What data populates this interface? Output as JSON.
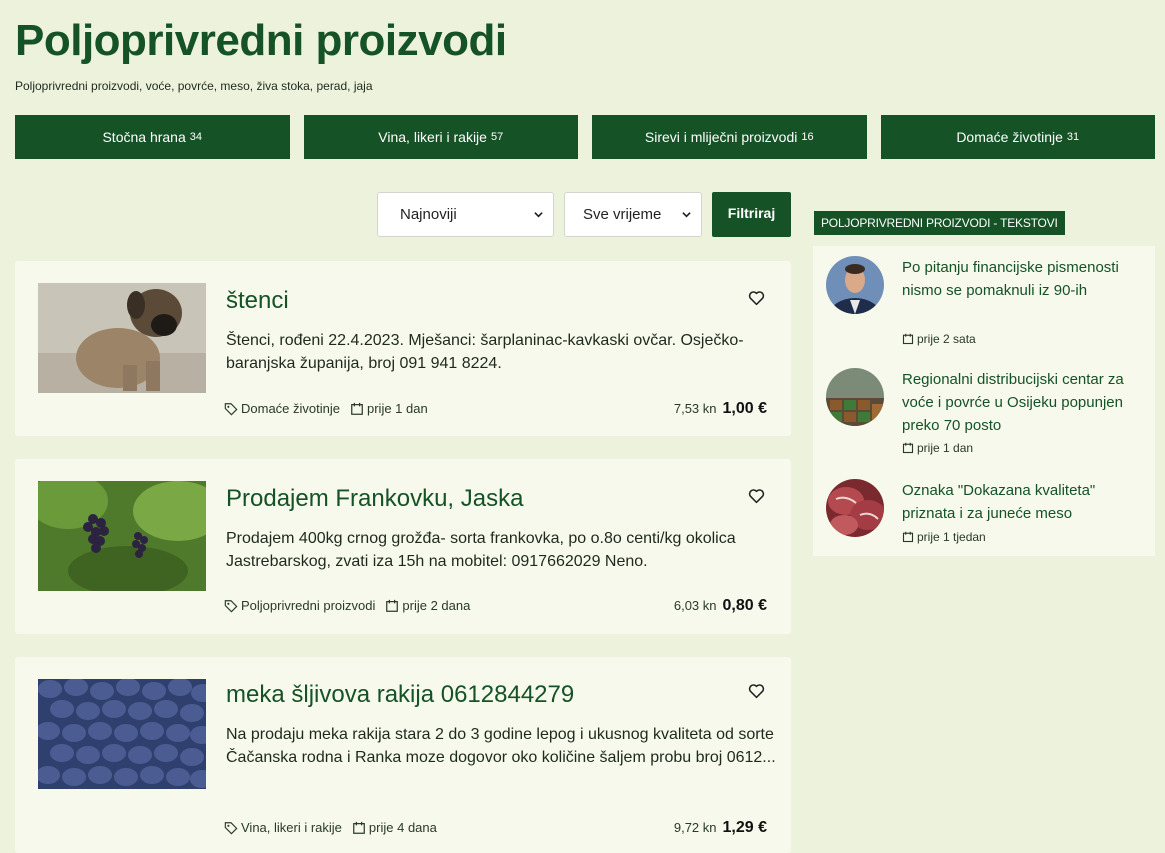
{
  "header": {
    "title": "Poljoprivredni proizvodi",
    "subtitle": "Poljoprivredni proizvodi, voće, povrće, meso, živa stoka, perad, jaja"
  },
  "categories": [
    {
      "label": "Stočna hrana",
      "count": "34"
    },
    {
      "label": "Vina, likeri i rakije",
      "count": "57"
    },
    {
      "label": "Sirevi i mliječni proizvodi",
      "count": "16"
    },
    {
      "label": "Domaće životinje",
      "count": "31"
    }
  ],
  "filters": {
    "sort_value": "Najnoviji",
    "time_value": "Sve vrijeme",
    "submit_label": "Filtriraj"
  },
  "listings": [
    {
      "title": "štenci",
      "description": "Štenci, rođeni 22.4.2023. Mješanci: šarplaninac-kavkaski ovčar. Osječko-baranjska županija, broj 091 941 8224.",
      "category": "Domaće životinje",
      "posted": "prije 1 dan",
      "price_kn": "7,53 kn",
      "price_eur": "1,00 €"
    },
    {
      "title": "Prodajem Frankovku, Jaska",
      "description": "Prodajem 400kg crnog grožđa- sorta frankovka, po o.8o centi/kg okolica Jastrebarskog, zvati iza 15h na mobitel: 0917662029 Neno.",
      "category": "Poljoprivredni proizvodi",
      "posted": "prije 2 dana",
      "price_kn": "6,03 kn",
      "price_eur": "0,80 €"
    },
    {
      "title": "meka šljivova rakija 0612844279",
      "description": "Na prodaju meka rakija stara 2 do 3 godine lepog i ukusnog kvaliteta od sorte Čačanska rodna i Ranka moze dogovor oko  količine šaljem probu broj 0612...",
      "category": "Vina, likeri i rakije",
      "posted": "prije 4 dana",
      "price_kn": "9,72 kn",
      "price_eur": "1,29 €"
    }
  ],
  "sidebar": {
    "heading": "POLJOPRIVREDNI PROIZVODI - TEKSTOVI",
    "articles": [
      {
        "title": "Po pitanju financijske pismenosti nismo se pomaknuli iz 90-ih",
        "time": "prije 2 sata"
      },
      {
        "title": "Regionalni distribucijski centar za voće i povrće u Osijeku popunjen preko 70 posto",
        "time": "prije 1 dan"
      },
      {
        "title": "Oznaka \"Dokazana kvaliteta\" priznata i za juneće meso",
        "time": "prije 1 tjedan"
      }
    ]
  },
  "icons": {
    "tag": "tag-icon",
    "calendar": "calendar-icon",
    "heart": "heart-icon",
    "chevron": "chevron-down-icon"
  },
  "colors": {
    "brand_green": "#155226",
    "background": "#edf2dc",
    "card": "#f6f9ec"
  }
}
